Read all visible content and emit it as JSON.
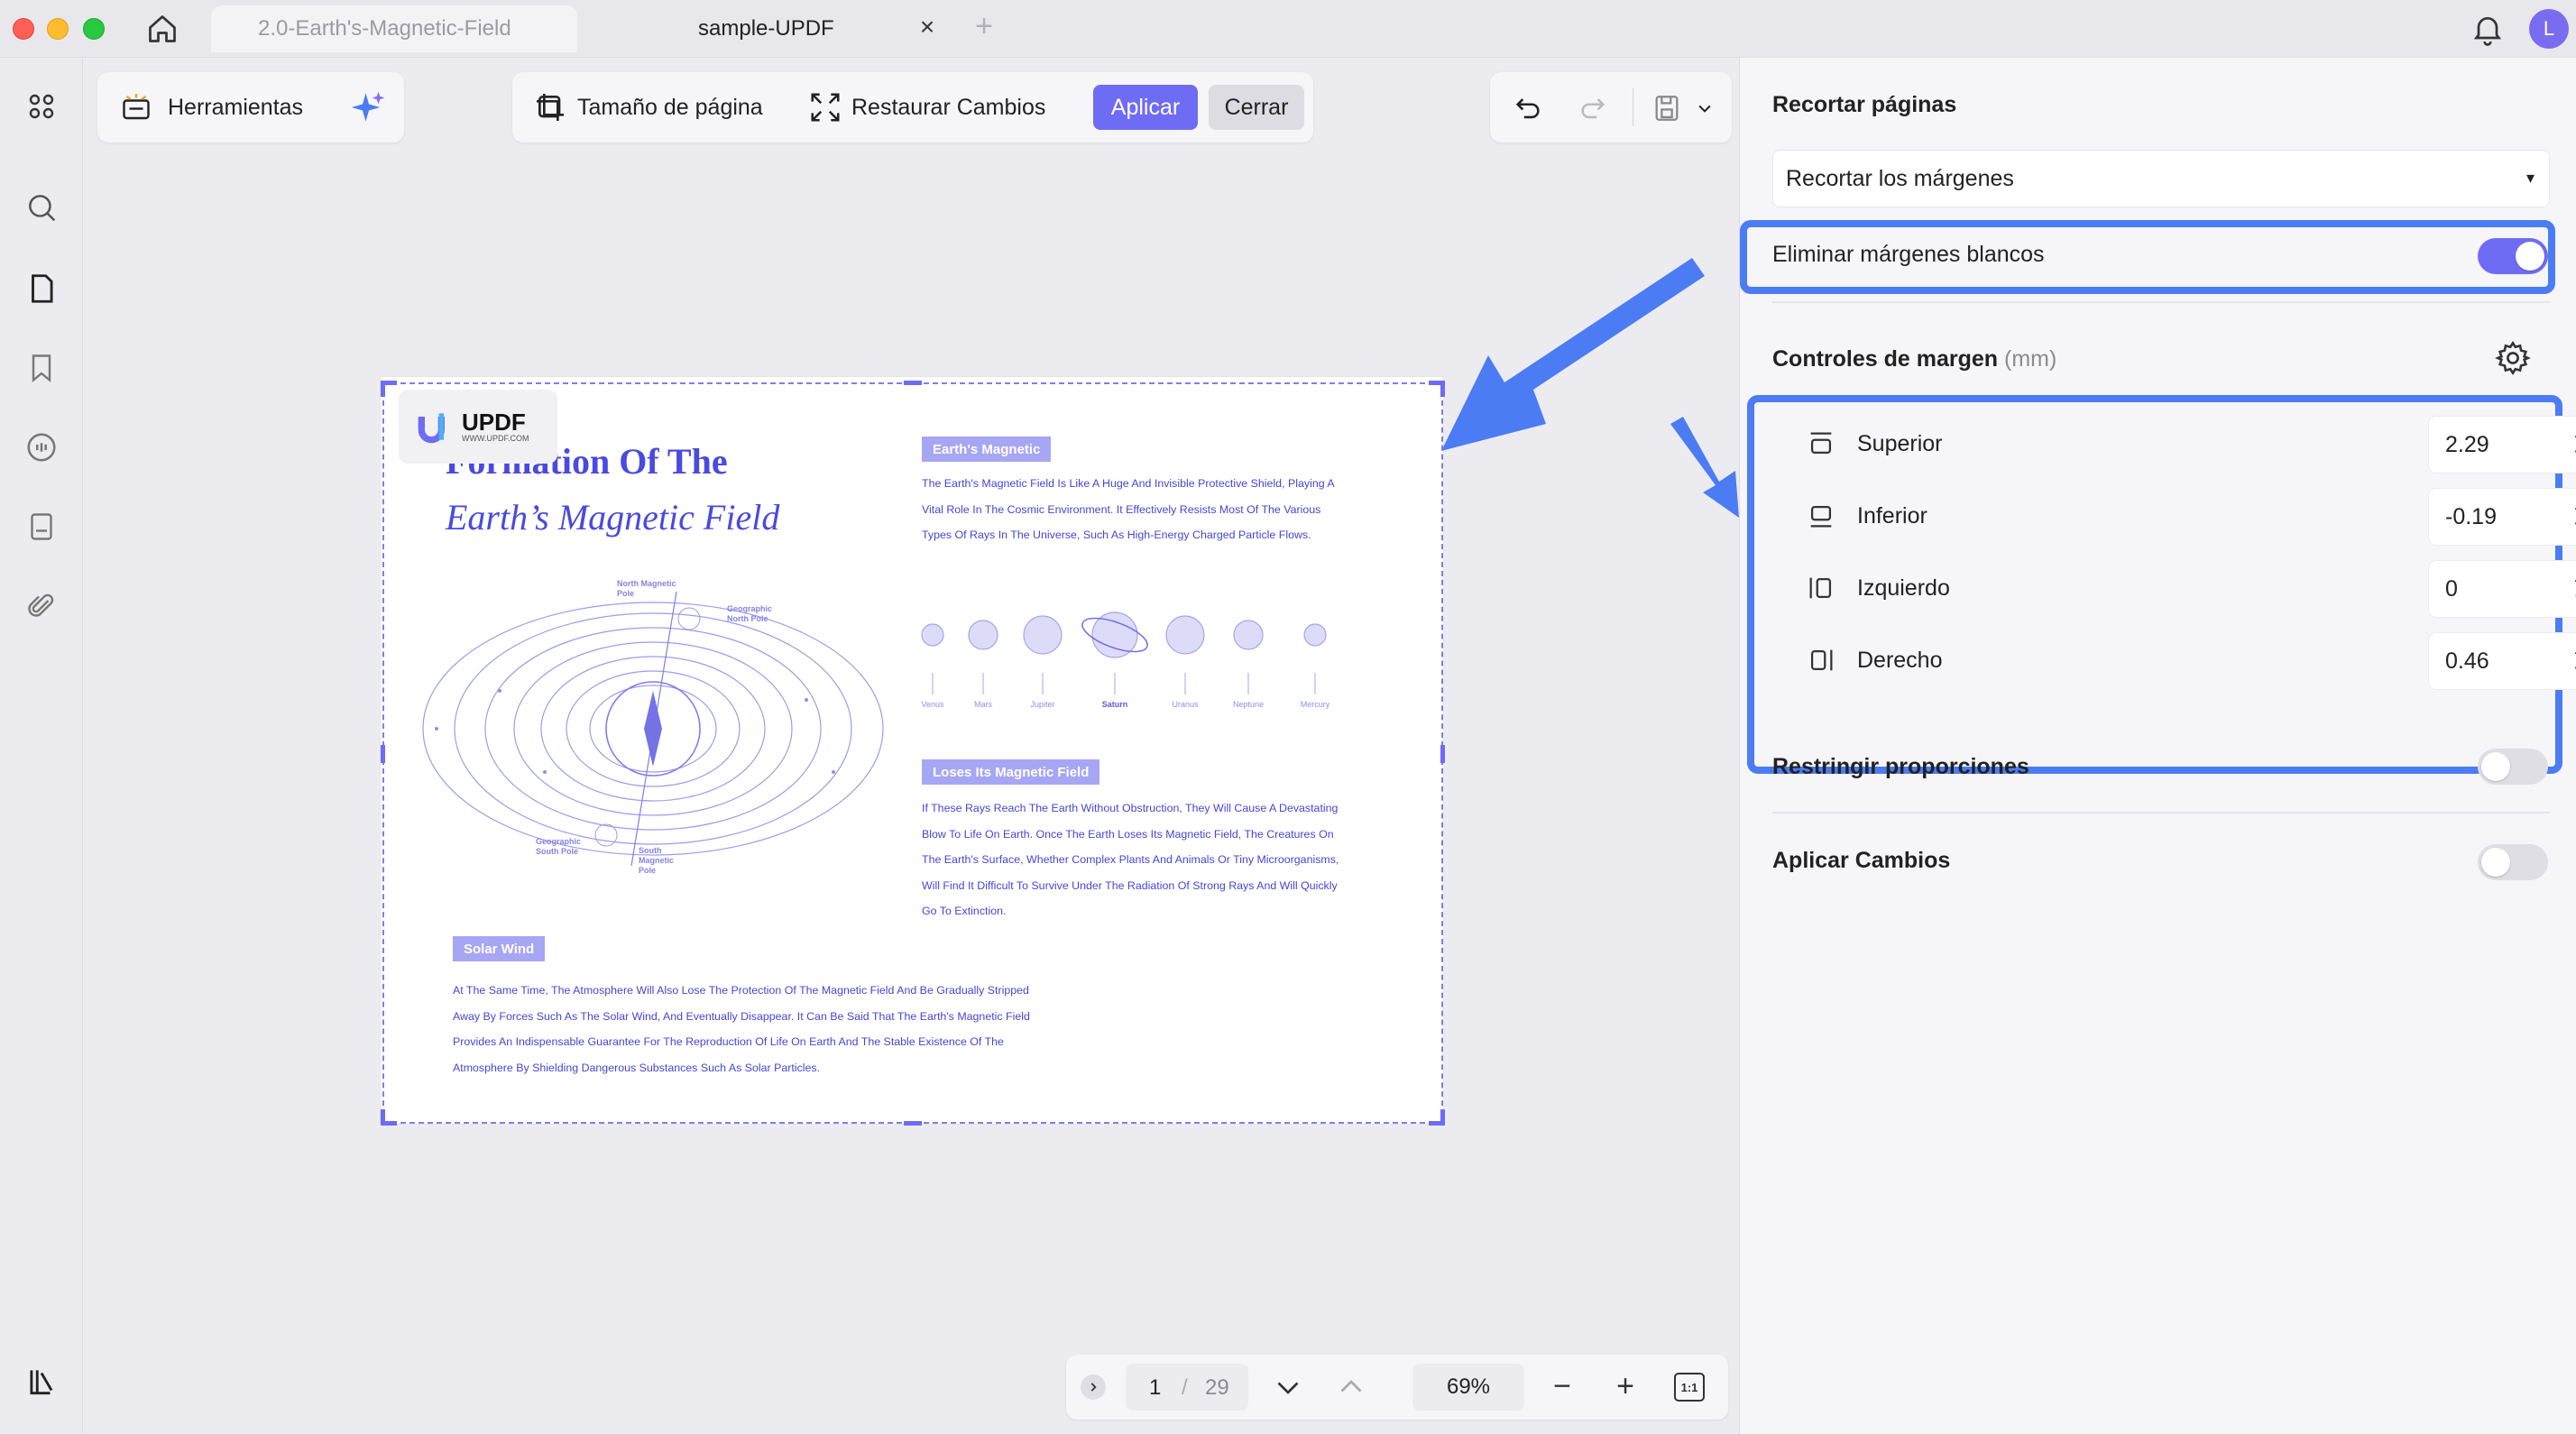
{
  "window": {
    "tabs": [
      {
        "label": "2.0-Earth's-Magnetic-Field",
        "active": false
      },
      {
        "label": "sample-UPDF",
        "active": true
      }
    ],
    "avatar_letter": "L"
  },
  "toolbar": {
    "tools_label": "Herramientas",
    "page_size_label": "Tamaño de página",
    "restore_label": "Restaurar Cambios",
    "apply_label": "Aplicar",
    "close_label": "Cerrar"
  },
  "document": {
    "badge_name": "UPDF",
    "badge_url": "WWW.UPDF.COM",
    "title_line1": "Formation Of The",
    "title_line2": "Earth’s Magnetic Field",
    "section1_tag": "Earth's Magnetic",
    "section1_text": "The Earth's Magnetic Field Is Like A Huge And Invisible Protective Shield, Playing A Vital Role In The Cosmic Environment. It Effectively Resists Most Of The Various Types Of Rays In The Universe, Such As High-Energy Charged Particle Flows.",
    "planets": [
      "Venus",
      "Mars",
      "Jupiter",
      "Saturn",
      "Uranus",
      "Neptune",
      "Mercury"
    ],
    "section2_tag": "Loses Its Magnetic Field",
    "section2_text": "If These Rays Reach The Earth Without Obstruction, They Will Cause A Devastating Blow To Life On Earth. Once The Earth Loses Its Magnetic Field, The Creatures On The Earth's Surface, Whether Complex Plants And Animals Or Tiny Microorganisms, Will Find It Difficult To Survive Under The Radiation Of Strong Rays And Will Quickly Go To Extinction.",
    "section3_tag": "Solar Wind",
    "section3_text": "At The Same Time, The Atmosphere Will Also Lose The Protection Of The Magnetic Field And Be Gradually Stripped Away By Forces Such As The Solar Wind, And Eventually Disappear. It Can Be Said That The Earth's Magnetic Field Provides An Indispensable Guarantee For The Reproduction Of Life On Earth And The Stable Existence Of The Atmosphere By Shielding Dangerous Substances Such As Solar Particles.",
    "diagram_labels": {
      "north_magnetic": "North Magnetic Pole",
      "geo_north": "Geographic North Pole",
      "geo_south": "Geographic South Pole",
      "south_magnetic": "South Magnetic Pole"
    }
  },
  "navigation": {
    "current_page": "1",
    "separator": "/",
    "total_pages": "29",
    "zoom": "69%",
    "fit_label": "1:1"
  },
  "panel": {
    "title": "Recortar páginas",
    "crop_mode": "Recortar los márgenes",
    "remove_white_margins_label": "Eliminar márgenes blancos",
    "remove_white_margins_on": true,
    "margin_controls_label": "Controles de margen",
    "margin_controls_unit": "(mm)",
    "margins": [
      {
        "label": "Superior",
        "value": "2.29"
      },
      {
        "label": "Inferior",
        "value": "-0.19"
      },
      {
        "label": "Izquierdo",
        "value": "0"
      },
      {
        "label": "Derecho",
        "value": "0.46"
      }
    ],
    "restrict_proportions_label": "Restringir proporciones",
    "restrict_proportions_on": false,
    "apply_changes_label": "Aplicar Cambios",
    "apply_changes_on": false
  },
  "colors": {
    "accent": "#6e6cf4",
    "annotation_blue": "#4b7cf4",
    "doc_text": "#4646d6"
  }
}
